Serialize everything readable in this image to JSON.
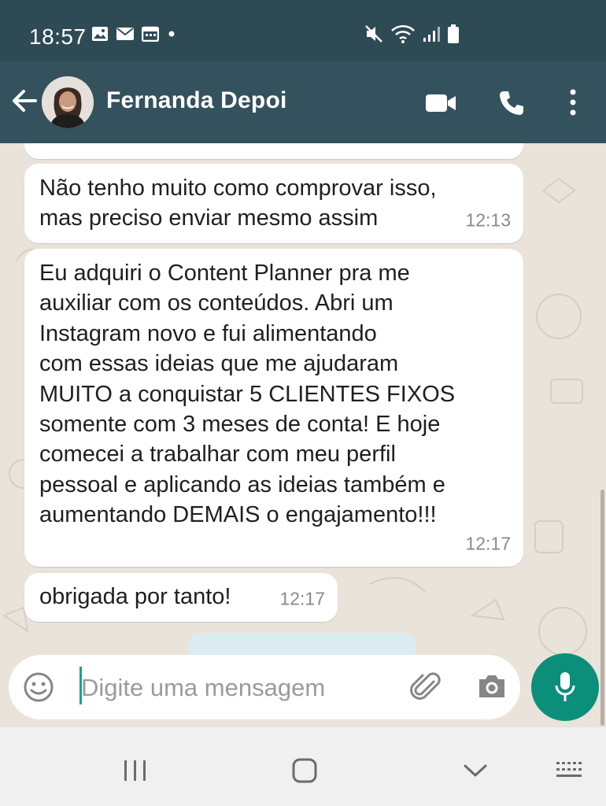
{
  "status_bar": {
    "time": "18:57",
    "icons_left": [
      "image-icon",
      "mail-icon",
      "calendar-icon",
      "dot-icon"
    ],
    "icons_right": [
      "mute-icon",
      "wifi-icon",
      "signal-icon",
      "battery-icon"
    ]
  },
  "header": {
    "contact_name": "Fernanda Depoi",
    "actions": [
      "video-call-icon",
      "phone-icon",
      "more-options-icon"
    ]
  },
  "messages": [
    {
      "text": "",
      "time": "12:13"
    },
    {
      "text": "Não tenho muito como comprovar isso,\nmas preciso enviar mesmo assim",
      "time": "12:13"
    },
    {
      "text": "Eu adquiri o Content Planner pra me\nauxiliar com os conteúdos. Abri um\nInstagram novo e fui alimentando\ncom essas ideias que me ajudaram\nMUITO a conquistar 5 CLIENTES FIXOS\nsomente com 3 meses de conta! E hoje\ncomecei a trabalhar com meu perfil\npessoal e aplicando as ideias também e\naumentando DEMAIS o engajamento!!!",
      "time": "12:17"
    },
    {
      "text": "obrigada por tanto!",
      "time": "12:17"
    }
  ],
  "composer": {
    "placeholder": "Digite uma mensagem",
    "icons": [
      "emoji-icon",
      "attach-icon",
      "camera-icon",
      "mic-icon"
    ]
  },
  "colors": {
    "status_bar": "#2e4a55",
    "toolbar": "#34515e",
    "mic_button": "#0b8f7a",
    "chat_background": "#e9e3da"
  }
}
